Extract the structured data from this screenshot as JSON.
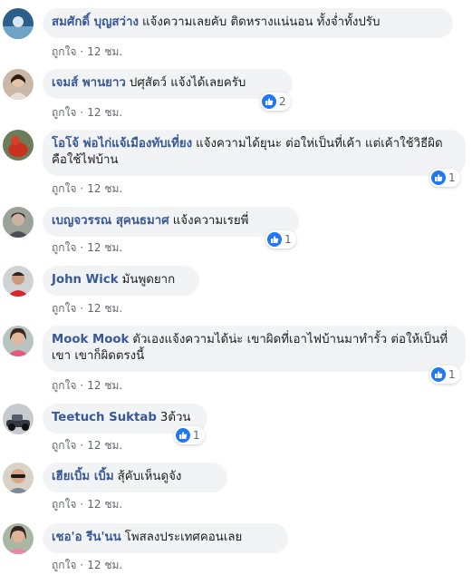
{
  "like_label": "ถูกใจ",
  "comments": [
    {
      "author": "สมศักดิ์ บุญสว่าง",
      "text": "แจ้งความเลยคับ ติดหรางแน่นอน ทั้งจ่ำทั้งปรับ",
      "time": "12 ชม."
    },
    {
      "author": "เจมส์ พานยาว",
      "text": "ปศุสัตว์ แจ้งได้เลยครับ",
      "time": "12 ชม.",
      "likes": "2"
    },
    {
      "author": "โอโจ้ พ่อไก่แจ้เมืองทับเที่ยง",
      "text": "แจ้งความได้ยุนะ ต่อให่เป็นที่เค้า แต่เค้าใช้วิธีผิด คือใช้ไฟบ้าน",
      "time": "12 ชม.",
      "likes": "1"
    },
    {
      "author": "เบญจวรรณ สุคนธมาศ",
      "text": "แจ้งความเรยพี่",
      "time": "12 ชม.",
      "likes": "1"
    },
    {
      "author": "John Wick",
      "text": "มันพูดยาก",
      "time": "12 ชม."
    },
    {
      "author": "Mook Mook",
      "text": "ตัวเองแจ้งความได้น่ะ เขาผิดที่เอาไฟบ้านมาทำรั้ว ต่อให้เป็นที่เขา เขาก็ผิดตรงนี้",
      "time": "12 ชม.",
      "likes": "1"
    },
    {
      "author": "Teetuch Suktab",
      "text": "3ต้วน",
      "time": "12 ชม.",
      "likes": "1"
    },
    {
      "author": "เฮียเบิ้ม เบิ้ม",
      "text": "สุ้คับเห็นดูจัง",
      "time": "12 ชม."
    },
    {
      "author": "เชอ'อ รีน'นน",
      "text": "โพสลงประเทศคอนเลย",
      "time": "12 ชม."
    }
  ]
}
